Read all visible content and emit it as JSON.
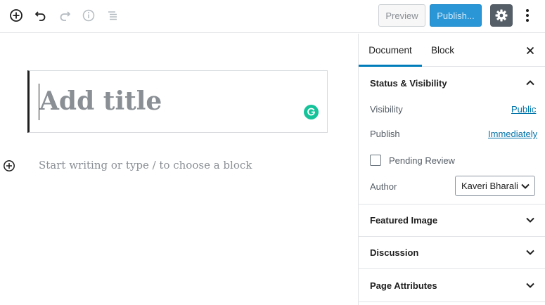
{
  "toolbar": {
    "add_block_icon": "plus-circle-icon",
    "undo_icon": "undo-icon",
    "redo_icon": "redo-icon",
    "info_icon": "info-icon",
    "outline_icon": "list-icon",
    "preview_label": "Preview",
    "publish_label": "Publish...",
    "settings_icon": "gear-icon",
    "more_icon": "vertical-ellipsis-icon"
  },
  "editor": {
    "title_placeholder": "Add title",
    "body_placeholder": "Start writing or type / to choose a block",
    "grammarly_icon": "grammarly-icon",
    "inline_add_icon": "plus-circle-icon"
  },
  "sidebar": {
    "tabs": [
      {
        "label": "Document",
        "active": true
      },
      {
        "label": "Block",
        "active": false
      }
    ],
    "close_icon": "close-icon",
    "status_visibility": {
      "title": "Status & Visibility",
      "expanded": true,
      "visibility_label": "Visibility",
      "visibility_value": "Public",
      "publish_label": "Publish",
      "publish_value": "Immediately",
      "pending_review_label": "Pending Review",
      "pending_review_checked": false,
      "author_label": "Author",
      "author_value": "Kaveri Bharali"
    },
    "panels": [
      {
        "title": "Featured Image",
        "expanded": false
      },
      {
        "title": "Discussion",
        "expanded": false
      },
      {
        "title": "Page Attributes",
        "expanded": false
      }
    ]
  },
  "colors": {
    "accent": "#007cba",
    "publish_button": "#2b96d6",
    "settings_button": "#555d66",
    "grammarly": "#15c39a",
    "link": "#0073aa"
  }
}
